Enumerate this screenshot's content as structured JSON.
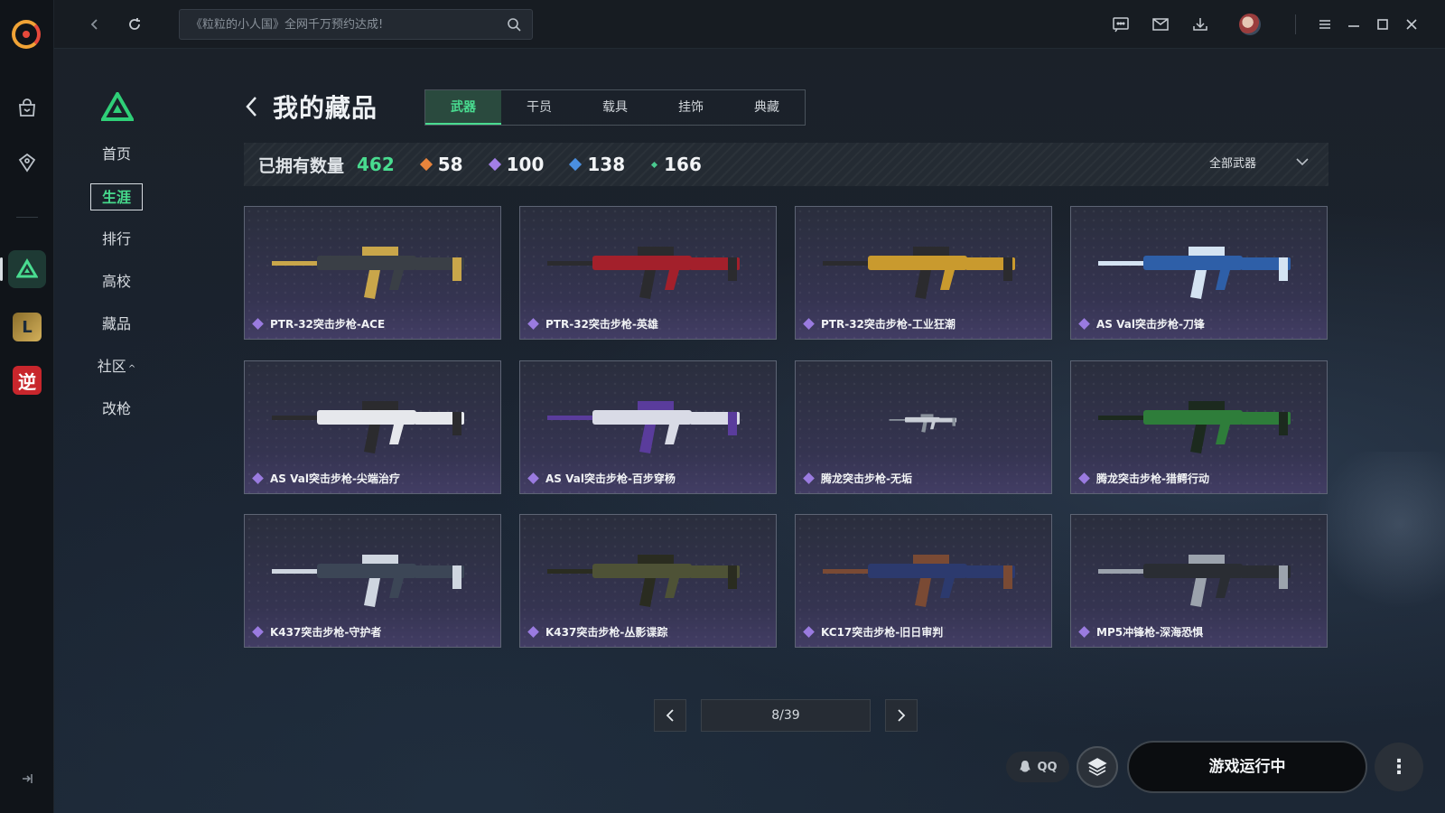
{
  "topbar": {
    "search_placeholder": "《粒粒的小人国》全网千万预约达成!",
    "icons": [
      "chat-icon",
      "mail-icon",
      "download-icon",
      "avatar",
      "menu-icon",
      "minimize-icon",
      "maximize-icon",
      "close-icon"
    ]
  },
  "rail": {
    "items": [
      "shop-icon",
      "discover-icon",
      "game-cf",
      "game-lol",
      "game-nishuihan"
    ],
    "lol_label": "L",
    "nishuihan_label": "逆"
  },
  "sidebar": {
    "items": [
      {
        "label": "首页"
      },
      {
        "label": "生涯"
      },
      {
        "label": "排行"
      },
      {
        "label": "高校"
      },
      {
        "label": "藏品"
      },
      {
        "label": "社区"
      },
      {
        "label": "改枪"
      }
    ],
    "active_index": 1
  },
  "page": {
    "title": "我的藏品",
    "tabs": [
      "武器",
      "干员",
      "载具",
      "挂饰",
      "典藏"
    ],
    "active_tab": 0
  },
  "stats": {
    "owned_label": "已拥有数量",
    "owned_total": "462",
    "tiers": [
      {
        "count": "58",
        "color": "#e8843c"
      },
      {
        "count": "100",
        "color": "#a27ee6"
      },
      {
        "count": "138",
        "color": "#4a8fe0"
      },
      {
        "count": "166",
        "color": "#49c98f"
      }
    ],
    "filter_label": "全部武器"
  },
  "items": [
    {
      "name": "PTR-32突击步枪-ACE",
      "skin": "#3a3f46",
      "accent": "#c9a64a"
    },
    {
      "name": "PTR-32突击步枪-英雄",
      "skin": "#a3202b",
      "accent": "#2b2b2e"
    },
    {
      "name": "PTR-32突击步枪-工业狂潮",
      "skin": "#c99a2e",
      "accent": "#2b2b2e"
    },
    {
      "name": "AS Val突击步枪-刀锋",
      "skin": "#2e5fa8",
      "accent": "#d4e3f2"
    },
    {
      "name": "AS Val突击步枪-尖端治疗",
      "skin": "#e6e8ec",
      "accent": "#2b2b2e"
    },
    {
      "name": "AS Val突击步枪-百步穿杨",
      "skin": "#d9dbe6",
      "accent": "#5a3c9c"
    },
    {
      "name": "腾龙突击步枪-无垢",
      "skin": "#c9ced6",
      "accent": "#8a929c"
    },
    {
      "name": "腾龙突击步枪-猎鳄行动",
      "skin": "#2e7d3a",
      "accent": "#1c2a1e"
    },
    {
      "name": "K437突击步枪-守护者",
      "skin": "#3c4656",
      "accent": "#cfd6e0"
    },
    {
      "name": "K437突击步枪-丛影谍踪",
      "skin": "#4e5236",
      "accent": "#2a2c20"
    },
    {
      "name": "KC17突击步枪-旧日审判",
      "skin": "#2c3a6e",
      "accent": "#7a4a34"
    },
    {
      "name": "MP5冲锋枪-深海恐惧",
      "skin": "#2a2d33",
      "accent": "#9ca3ad"
    }
  ],
  "pager": {
    "info": "8/39"
  },
  "bottom": {
    "qq_label": "QQ",
    "run_label": "游戏运行中"
  }
}
